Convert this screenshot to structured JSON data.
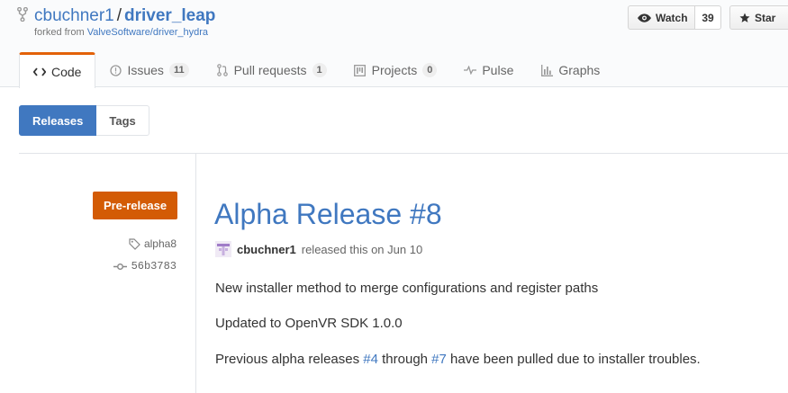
{
  "repo": {
    "owner": "cbuchner1",
    "separator": "/",
    "name": "driver_leap",
    "forked_prefix": "forked from",
    "forked_from": "ValveSoftware/driver_hydra"
  },
  "actions": {
    "watch_label": "Watch",
    "watch_count": "39",
    "star_label": "Star"
  },
  "tabs": [
    {
      "label": "Code",
      "icon": "code-icon",
      "counter": null
    },
    {
      "label": "Issues",
      "icon": "issue-icon",
      "counter": "11"
    },
    {
      "label": "Pull requests",
      "icon": "pull-request-icon",
      "counter": "1"
    },
    {
      "label": "Projects",
      "icon": "project-icon",
      "counter": "0"
    },
    {
      "label": "Pulse",
      "icon": "pulse-icon",
      "counter": null
    },
    {
      "label": "Graphs",
      "icon": "graph-icon",
      "counter": null
    }
  ],
  "subnav": {
    "releases": "Releases",
    "tags": "Tags"
  },
  "release": {
    "badge": "Pre-release",
    "tag": "alpha8",
    "commit": "56b3783",
    "title": "Alpha Release #8",
    "author": "cbuchner1",
    "released_text": "released this on Jun 10",
    "notes": [
      "New installer method to merge configurations and register paths",
      "Updated to OpenVR SDK 1.0.0"
    ],
    "line3": {
      "prefix": "Previous alpha releases",
      "link1": "#4",
      "middle": "through",
      "link2": "#7",
      "suffix": "have been pulled due to installer troubles."
    }
  },
  "colors": {
    "link": "#4078c0",
    "prerelease": "#d35b05",
    "selected_tab_accent": "#e36209"
  }
}
